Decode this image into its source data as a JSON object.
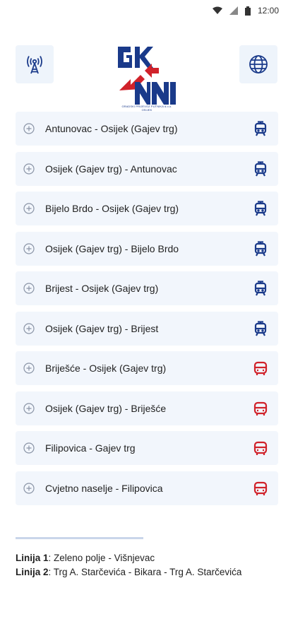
{
  "status": {
    "time": "12:00"
  },
  "header": {
    "logo_text": "GKNN",
    "logo_subtitle": "GRADSKI PRIJEVOZ PUTNIKA d.o.o. OSIJEK"
  },
  "colors": {
    "tram": "#1a3a8a",
    "bus": "#d0222a",
    "card_bg": "#f2f6fc"
  },
  "routes": [
    {
      "label": "Antunovac - Osijek (Gajev trg)",
      "vehicle": "tram-icon"
    },
    {
      "label": "Osijek (Gajev trg) - Antunovac",
      "vehicle": "tram-icon"
    },
    {
      "label": "Bijelo Brdo - Osijek (Gajev trg)",
      "vehicle": "tram-icon"
    },
    {
      "label": "Osijek (Gajev trg) - Bijelo Brdo",
      "vehicle": "tram-icon"
    },
    {
      "label": "Brijest - Osijek (Gajev trg)",
      "vehicle": "tram-icon"
    },
    {
      "label": "Osijek (Gajev trg) - Brijest",
      "vehicle": "tram-icon"
    },
    {
      "label": "Briješće - Osijek (Gajev trg)",
      "vehicle": "bus-icon"
    },
    {
      "label": "Osijek (Gajev trg) - Briješće",
      "vehicle": "bus-icon"
    },
    {
      "label": "Filipovica - Gajev trg",
      "vehicle": "bus-icon"
    },
    {
      "label": "Cvjetno naselje - Filipovica",
      "vehicle": "bus-icon"
    }
  ],
  "lines": [
    {
      "name": "Linija 1",
      "route": ": Zeleno polje - Višnjevac"
    },
    {
      "name": "Linija 2",
      "route": ": Trg A. Starčevića - Bikara - Trg A. Starčevića"
    }
  ]
}
